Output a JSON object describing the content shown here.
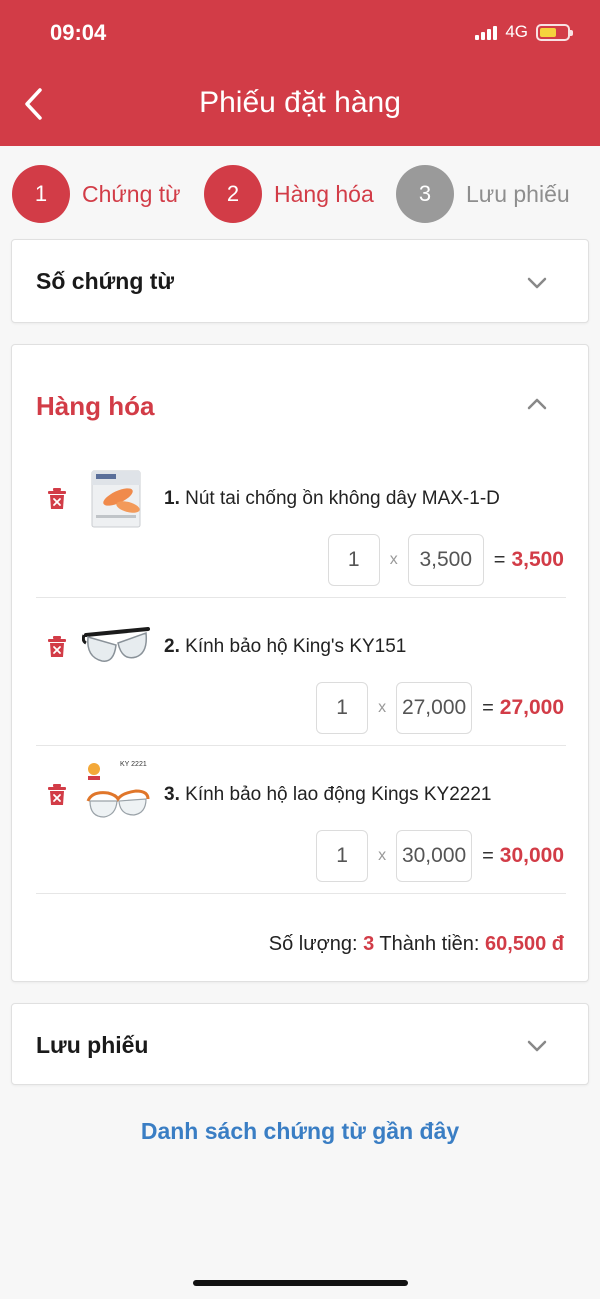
{
  "status_bar": {
    "time": "09:04",
    "network": "4G"
  },
  "header": {
    "title": "Phiếu đặt hàng"
  },
  "steps": [
    {
      "number": "1",
      "label": "Chứng từ",
      "active": true
    },
    {
      "number": "2",
      "label": "Hàng hóa",
      "active": true
    },
    {
      "number": "3",
      "label": "Lưu phiếu",
      "active": false
    }
  ],
  "sections": {
    "document_number": {
      "title": "Số chứng từ"
    },
    "goods": {
      "title": "Hàng hóa"
    },
    "save": {
      "title": "Lưu phiếu"
    }
  },
  "items": [
    {
      "index": "1.",
      "name": "Nút tai chống ồn không dây MAX-1-D",
      "qty": "1",
      "price": "3,500",
      "total": "3,500",
      "thumb_icon": "earplug-box-thumbnail"
    },
    {
      "index": "2.",
      "name": "Kính bảo hộ King's KY151",
      "qty": "1",
      "price": "27,000",
      "total": "27,000",
      "thumb_icon": "safety-glasses-thumbnail"
    },
    {
      "index": "3.",
      "name": "Kính bảo hộ lao động Kings KY2221",
      "qty": "1",
      "price": "30,000",
      "total": "30,000",
      "thumb_icon": "safety-glasses-thumbnail",
      "thumb_caption": "KY 2221"
    }
  ],
  "operators": {
    "times": "x",
    "equals": "="
  },
  "summary": {
    "quantity_label": "Số lượng:",
    "quantity_value": "3",
    "amount_label": "Thành tiền:",
    "amount_value": "60,500 đ"
  },
  "recent_link": "Danh sách chứng từ gần đây",
  "colors": {
    "accent": "#d23c47",
    "link": "#3a7ec4",
    "inactive": "#9a9a9a"
  }
}
